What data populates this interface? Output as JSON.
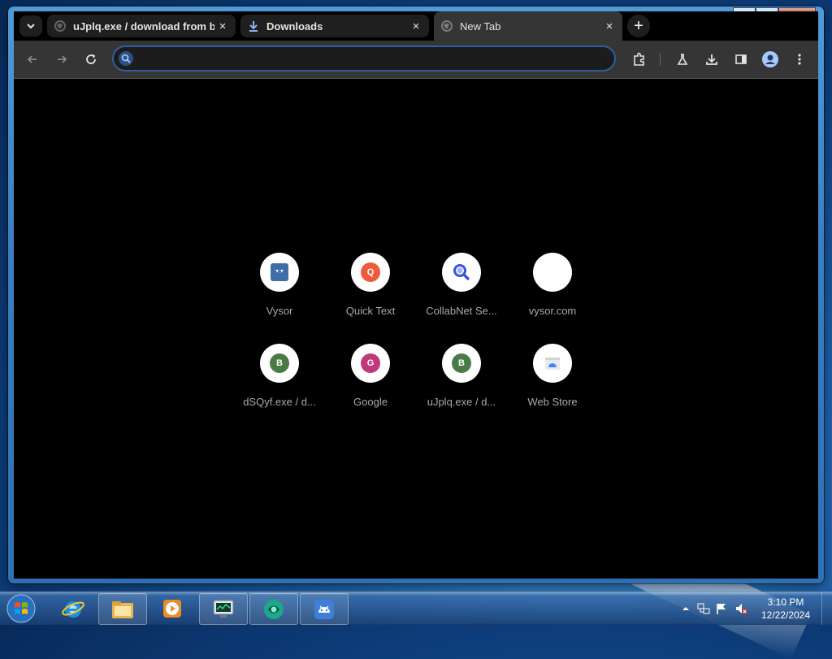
{
  "browser": {
    "tab_search_icon": "chevron-down-icon",
    "tabs": [
      {
        "title": "uJplq.exe / download from ba",
        "icon": "globe-icon",
        "active": false
      },
      {
        "title": "Downloads",
        "icon": "download-icon",
        "active": false
      },
      {
        "title": "New Tab",
        "icon": "globe-icon",
        "active": true
      }
    ],
    "close_glyph": "×",
    "new_tab_glyph": "+",
    "window_controls": {
      "minimize": "▁",
      "maximize": "□",
      "close": "✕"
    },
    "toolbar": {
      "back_icon": "arrow-left-icon",
      "forward_icon": "arrow-right-icon",
      "reload_icon": "reload-icon",
      "omnibox_value": "",
      "omnibox_placeholder": "",
      "right_icons": [
        "extensions-icon",
        "labs-icon",
        "download-icon",
        "side-panel-icon",
        "profile-icon",
        "menu-icon"
      ]
    },
    "accent": "#2f5f9e"
  },
  "shortcuts": [
    {
      "label": "Vysor",
      "icon": "vysor-icon"
    },
    {
      "label": "Quick Text",
      "icon": "quick-text-icon",
      "letter": "Q",
      "color": "#ef5a3c"
    },
    {
      "label": "CollabNet Se...",
      "icon": "collabnet-icon"
    },
    {
      "label": "vysor.com",
      "icon": "blank-icon"
    },
    {
      "label": "dSQyf.exe / d...",
      "icon": "letter-b-icon",
      "letter": "B",
      "color": "#4a7a45"
    },
    {
      "label": "Google",
      "icon": "letter-g-icon",
      "letter": "G",
      "color": "#c0397a"
    },
    {
      "label": "uJplq.exe / d...",
      "icon": "letter-b-icon",
      "letter": "B",
      "color": "#4a7a45"
    },
    {
      "label": "Web Store",
      "icon": "web-store-icon"
    }
  ],
  "taskbar": {
    "items": [
      "windows-start-icon",
      "internet-explorer-icon",
      "file-explorer-icon",
      "media-player-icon",
      "task-manager-icon",
      "app-icon",
      "android-icon"
    ],
    "tray": [
      "show-hidden-icon",
      "network-icon",
      "action-center-icon",
      "volume-muted-icon"
    ],
    "time": "3:10 PM",
    "date": "12/22/2024"
  }
}
